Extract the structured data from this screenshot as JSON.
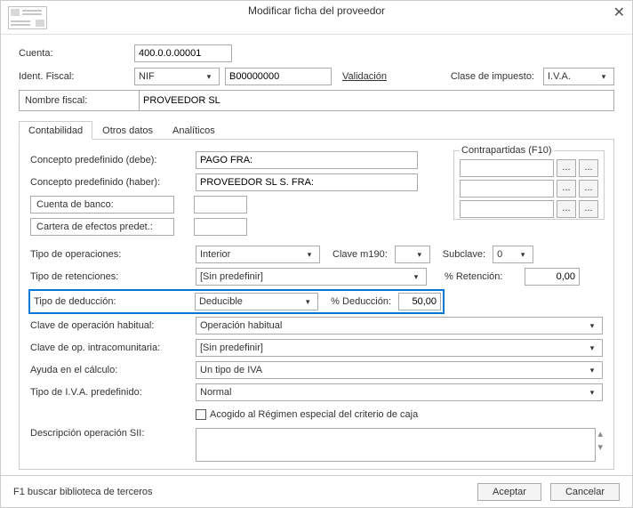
{
  "title": "Modificar ficha del proveedor",
  "header": {
    "cuenta_label": "Cuenta:",
    "cuenta_value": "400.0.0.00001",
    "ident_label": "Ident. Fiscal:",
    "ident_type": "NIF",
    "ident_value": "B00000000",
    "validacion": "Validación",
    "clase_label": "Clase de impuesto:",
    "clase_value": "I.V.A.",
    "nombre_label": "Nombre fiscal:",
    "nombre_value": "PROVEEDOR SL"
  },
  "tabs": {
    "t0": "Contabilidad",
    "t1": "Otros datos",
    "t2": "Analíticos"
  },
  "panel": {
    "concepto_debe_l": "Concepto predefinido (debe):",
    "concepto_debe_v": "PAGO FRA:",
    "concepto_haber_l": "Concepto predefinido (haber):",
    "concepto_haber_v": "PROVEEDOR SL S. FRA:",
    "cuenta_banco_l": "Cuenta de banco:",
    "cartera_l": "Cartera de efectos predet.:",
    "tipo_oper_l": "Tipo de operaciones:",
    "tipo_oper_v": "Interior",
    "clave190_l": "Clave m190:",
    "subclave_l": "Subclave:",
    "subclave_v": "0",
    "tipo_ret_l": "Tipo de retenciones:",
    "tipo_ret_v": "[Sin predefinir]",
    "pct_ret_l": "% Retención:",
    "pct_ret_v": "0,00",
    "tipo_ded_l": "Tipo de deducción:",
    "tipo_ded_v": "Deducible",
    "pct_ded_l": "% Deducción:",
    "pct_ded_v": "50,00",
    "clave_op_l": "Clave de operación habitual:",
    "clave_op_v": "Operación habitual",
    "clave_ic_l": "Clave de op. intracomunitaria:",
    "clave_ic_v": "[Sin predefinir]",
    "ayuda_l": "Ayuda en el cálculo:",
    "ayuda_v": "Un tipo de IVA",
    "tipo_iva_l": "Tipo de I.V.A. predefinido:",
    "tipo_iva_v": "Normal",
    "acogido_l": "Acogido al Régimen especial del criterio de caja",
    "desc_sii_l": "Descripción operación SII:",
    "contrapartidas_l": "Contrapartidas (F10)",
    "dots": "..."
  },
  "footer": {
    "f1": "F1 buscar biblioteca de terceros",
    "ok": "Aceptar",
    "cancel": "Cancelar"
  }
}
